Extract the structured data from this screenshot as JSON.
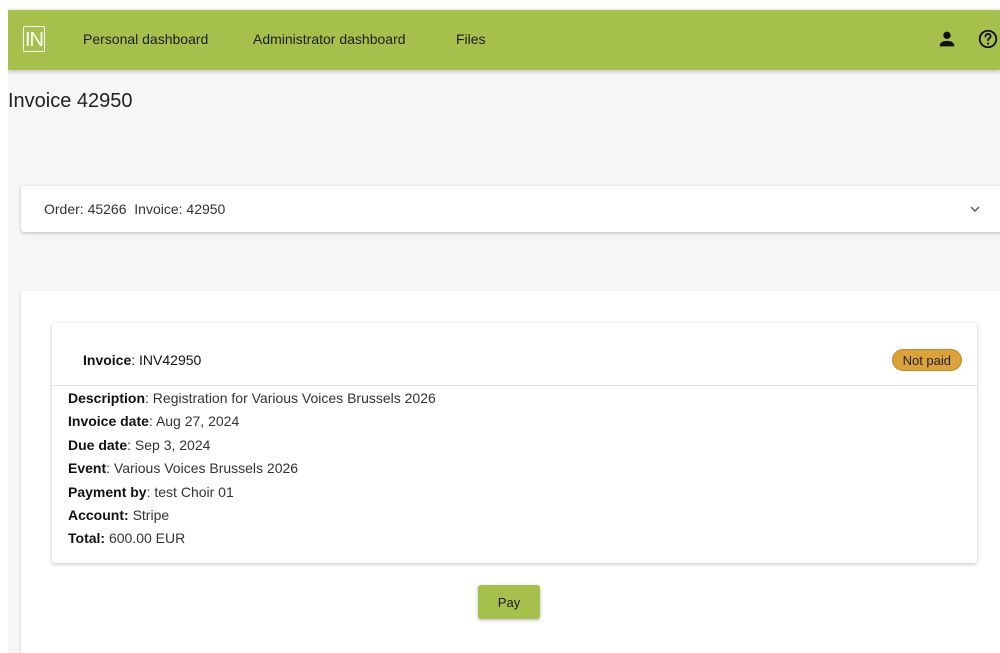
{
  "navbar": {
    "logo_text": "IN",
    "links": [
      {
        "label": "Personal dashboard"
      },
      {
        "label": "Administrator dashboard"
      },
      {
        "label": "Files"
      }
    ],
    "icons": [
      "user-icon",
      "help-circle-icon"
    ]
  },
  "page": {
    "title": "Invoice 42950"
  },
  "accordion": {
    "summary": "Order: 45266  Invoice: 42950",
    "icon": "chevron-down-icon"
  },
  "invoice": {
    "title_label": "Invoice",
    "title_value": ": INV42950",
    "status": "Not paid",
    "rows": [
      {
        "label": "Description",
        "sep": ": ",
        "value": "Registration for Various Voices Brussels 2026"
      },
      {
        "label": "Invoice date",
        "sep": ": ",
        "value": "Aug 27, 2024"
      },
      {
        "label": "Due date",
        "sep": ": ",
        "value": "Sep 3, 2024"
      },
      {
        "label": "Event",
        "sep": ": ",
        "value": "Various Voices Brussels 2026"
      },
      {
        "label": "Payment by",
        "sep": ": ",
        "value": "test Choir 01"
      },
      {
        "label": "Account:",
        "sep": " ",
        "value": "Stripe"
      },
      {
        "label": "Total:",
        "sep": " ",
        "value": "600.00 EUR"
      }
    ]
  },
  "actions": {
    "pay_label": "Pay"
  },
  "colors": {
    "brand": "#a6c04c",
    "status_unpaid": "#dba23a",
    "background": "#f6f6f6"
  }
}
